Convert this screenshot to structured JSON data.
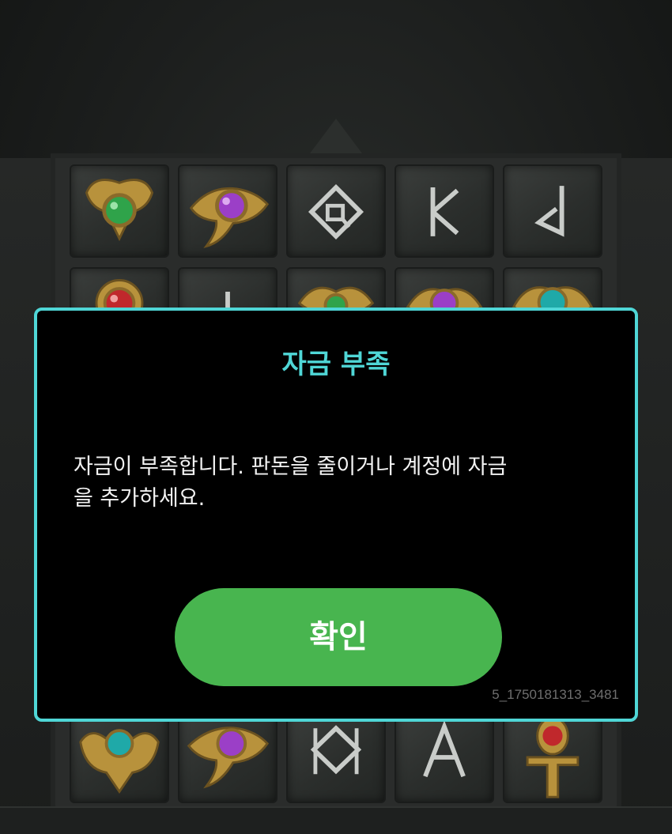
{
  "game": {
    "reels": {
      "row1": [
        "gold-scarab-green-gem",
        "eye-of-horus-purple-gem",
        "rune-diamond",
        "rune-k",
        "rune-j"
      ],
      "row2": [
        "gold-amulet-red-gem",
        "rune-t",
        "gold-scarab-green-gem",
        "gold-amulet-purple-gem",
        "gold-scarab-teal-gem"
      ],
      "row5": [
        "gold-scarab-teal-gem",
        "eye-of-horus-purple-gem",
        "rune-diamond",
        "rune-a",
        "ankh-red-gem"
      ]
    },
    "colors": {
      "accent": "#4fd6d6",
      "confirm": "#48b54f",
      "gold": "#b8923c",
      "green_gem": "#2fa34a",
      "purple_gem": "#9b3fc7",
      "red_gem": "#c0282c",
      "teal_gem": "#1fa9a8"
    }
  },
  "dialog": {
    "title": "자금 부족",
    "message_line1": "자금이 부족합니다. 판돈을 줄이거나 계정에 자금",
    "message_line2": "을 추가하세요.",
    "confirm_label": "확인",
    "id_text": "5_1750181313_3481"
  }
}
